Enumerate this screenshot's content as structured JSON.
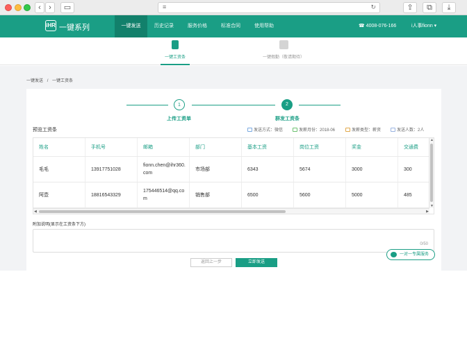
{
  "brand": {
    "logo_mark": "iHR",
    "name": "一键系列"
  },
  "nav": {
    "items": [
      "一键发送",
      "历史记录",
      "服务价格",
      "标准合同",
      "使用帮助"
    ],
    "active_index": 0,
    "phone": "4008-076-166",
    "user": "i人事fionn"
  },
  "subnav": {
    "tabs": [
      {
        "label": "一键工资条",
        "icon": "payslip-icon",
        "active": true
      },
      {
        "label": "一键假勤（敬请期待）",
        "icon": "calendar-icon",
        "active": false
      }
    ]
  },
  "breadcrumb": [
    "一键发送",
    "/",
    "一键工资条"
  ],
  "steps": [
    {
      "num": "1",
      "label": "上传工资单"
    },
    {
      "num": "2",
      "label": "群发工资条"
    }
  ],
  "preview": {
    "title": "预览工资条",
    "send_method": "发送方式：微信",
    "pay_month": "发薪月份：2018-06",
    "pay_type": "发薪类型：薪资",
    "send_count": "发送人数：2人"
  },
  "table": {
    "columns": [
      "姓名",
      "手机号",
      "邮箱",
      "部门",
      "基本工资",
      "岗位工资",
      "奖金",
      "交通费"
    ],
    "rows": [
      [
        "毛毛",
        "13917751028",
        "fionn.chen@ihr360.com",
        "市场部",
        "6343",
        "5674",
        "3000",
        "300"
      ],
      [
        "阿壶",
        "18816543329",
        "175446514@qq.com",
        "销售部",
        "6500",
        "5600",
        "5000",
        "485"
      ]
    ]
  },
  "note": {
    "label": "附加说明(显示在工资条下方)",
    "counter": "0/50",
    "placeholder": ""
  },
  "buttons": {
    "back": "返回上一步",
    "send": "立即发送"
  },
  "service": {
    "label": "一对一专属服务"
  },
  "colors": {
    "brand": "#1a9e85",
    "brand_dark": "#12806b"
  }
}
